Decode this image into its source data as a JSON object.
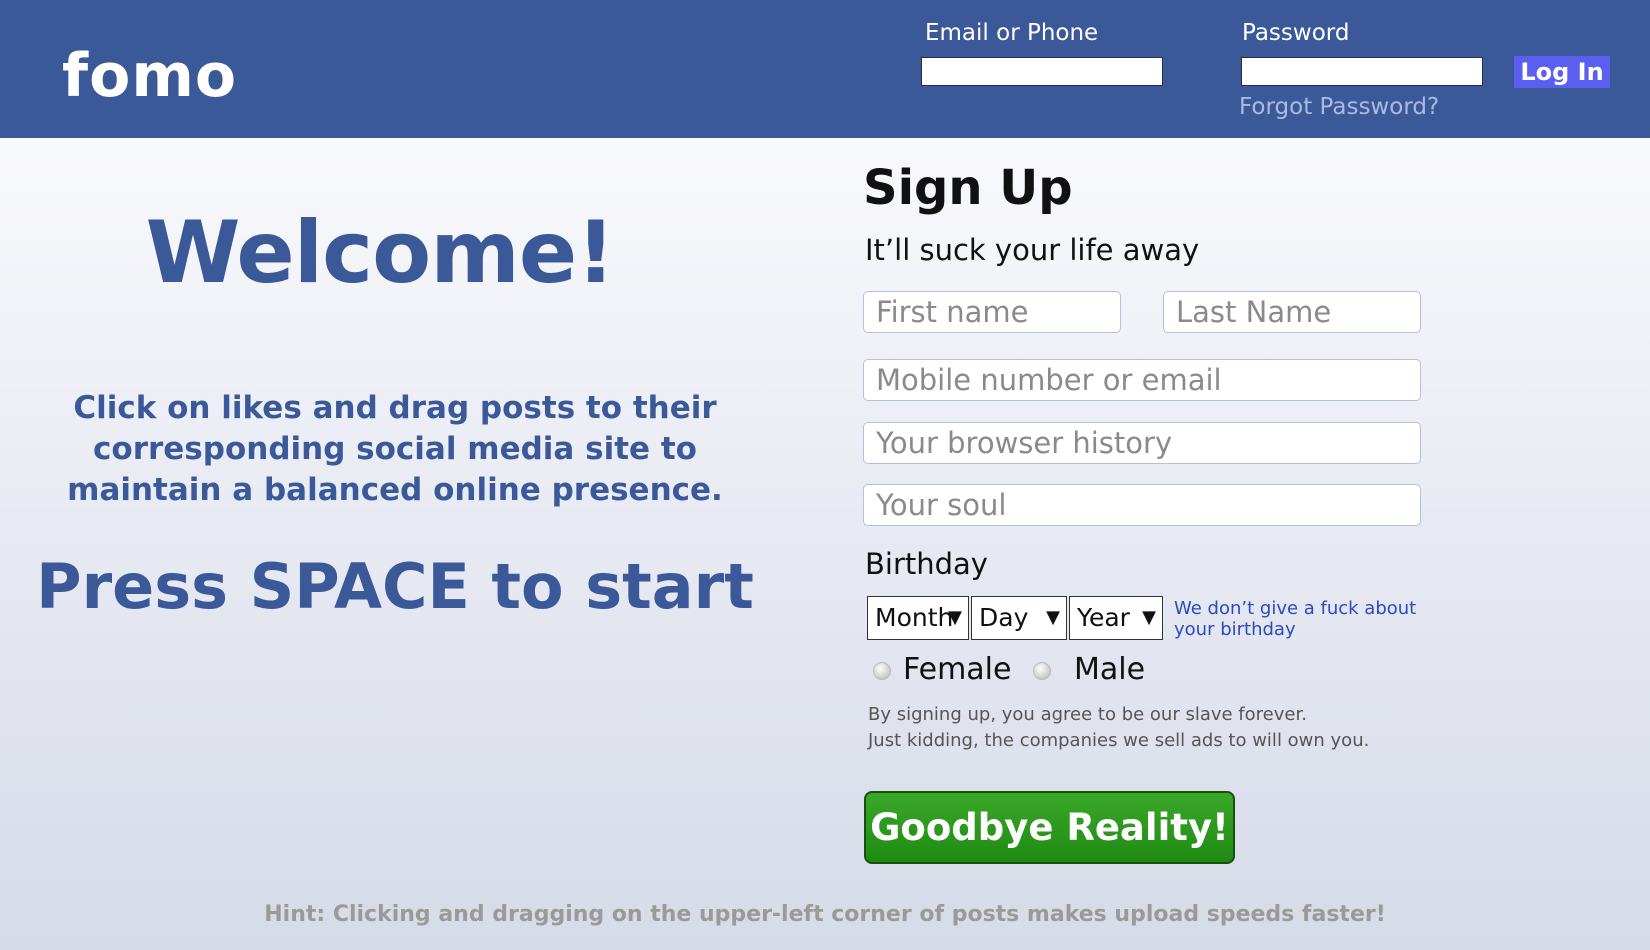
{
  "header": {
    "logo": "fomo",
    "email_label": "Email or Phone",
    "password_label": "Password",
    "login_button": "Log In",
    "forgot_password": "Forgot Password?"
  },
  "intro": {
    "welcome": "Welcome!",
    "instructions": "Click on likes and drag posts to their corresponding social media site to maintain a balanced online presence.",
    "press_start": "Press SPACE to start"
  },
  "signup": {
    "title": "Sign Up",
    "subtitle": "It’ll suck your life away",
    "first_name_placeholder": "First name",
    "last_name_placeholder": "Last Name",
    "contact_placeholder": "Mobile number or email",
    "history_placeholder": "Your browser history",
    "soul_placeholder": "Your soul",
    "birthday_label": "Birthday",
    "month": "Month",
    "day": "Day",
    "year": "Year",
    "birthday_note": "We don’t give a fuck about your birthday",
    "female": "Female",
    "male": "Male",
    "terms_line1": "By signing up, you agree to be our slave forever.",
    "terms_line2": "Just kidding, the companies we sell ads to will own you.",
    "submit": "Goodbye Reality!"
  },
  "hint": "Hint: Clicking and dragging on the upper-left corner of posts makes upload speeds faster!",
  "colors": {
    "brand": "#3b5998",
    "login_button": "#5b5ff0",
    "submit_button": "#2a9a1e"
  }
}
